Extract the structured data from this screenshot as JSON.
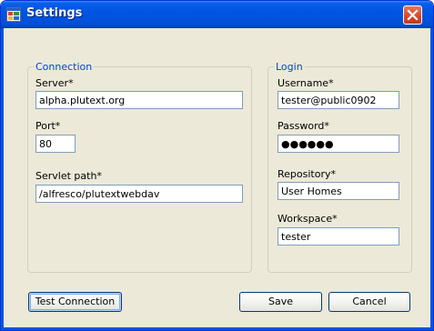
{
  "window": {
    "title": "Settings",
    "title_icon": "settings-app-icon",
    "close_icon": "close-icon"
  },
  "connection": {
    "group_label": "Connection",
    "server_label": "Server*",
    "server_value": "alpha.plutext.org",
    "port_label": "Port*",
    "port_value": "80",
    "servlet_label": "Servlet path*",
    "servlet_value": "/alfresco/plutextwebdav"
  },
  "login": {
    "group_label": "Login",
    "username_label": "Username*",
    "username_value": "tester@public0902",
    "password_label": "Password*",
    "password_value": "●●●●●●",
    "repository_label": "Repository*",
    "repository_value": "User Homes",
    "workspace_label": "Workspace*",
    "workspace_value": "tester"
  },
  "buttons": {
    "test_connection": "Test Connection",
    "save": "Save",
    "cancel": "Cancel"
  },
  "colors": {
    "title_bar": "#0054e3",
    "group_label": "#0046d5",
    "close_button": "#d6472a",
    "dialog_background": "#ece9d8"
  }
}
